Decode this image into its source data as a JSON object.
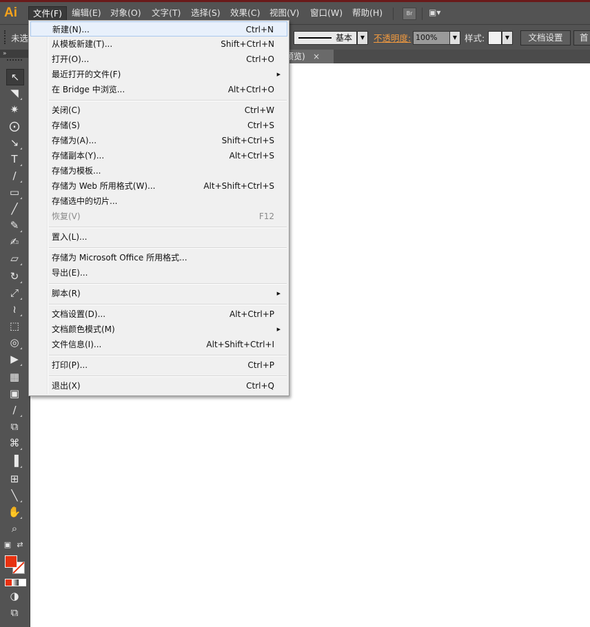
{
  "app": {
    "logo": "Ai"
  },
  "menubar": {
    "items": [
      "文件(F)",
      "编辑(E)",
      "对象(O)",
      "文字(T)",
      "选择(S)",
      "效果(C)",
      "视图(V)",
      "窗口(W)",
      "帮助(H)"
    ],
    "bridge_button": "Br",
    "workspace_button": "▣▾"
  },
  "control_bar": {
    "selection_label": "未选",
    "stroke_style": "基本",
    "opacity_label": "不透明度:",
    "opacity_value": "100%",
    "style_label": "样式:",
    "doc_setup_button": "文档设置",
    "first_button": "首"
  },
  "document_tab": {
    "label": "预览)",
    "close": "×"
  },
  "toolbar": {
    "collapse": "»"
  },
  "file_menu": [
    {
      "label": "新建(N)...",
      "shortcut": "Ctrl+N",
      "highlighted": true
    },
    {
      "label": "从模板新建(T)...",
      "shortcut": "Shift+Ctrl+N"
    },
    {
      "label": "打开(O)...",
      "shortcut": "Ctrl+O"
    },
    {
      "label": "最近打开的文件(F)",
      "shortcut": "",
      "submenu": true
    },
    {
      "label": "在 Bridge 中浏览...",
      "shortcut": "Alt+Ctrl+O"
    },
    {
      "label": "关闭(C)",
      "shortcut": "Ctrl+W"
    },
    {
      "label": "存储(S)",
      "shortcut": "Ctrl+S"
    },
    {
      "label": "存储为(A)...",
      "shortcut": "Shift+Ctrl+S"
    },
    {
      "label": "存储副本(Y)...",
      "shortcut": "Alt+Ctrl+S"
    },
    {
      "label": "存储为模板...",
      "shortcut": ""
    },
    {
      "label": "存储为 Web 所用格式(W)...",
      "shortcut": "Alt+Shift+Ctrl+S"
    },
    {
      "label": "存储选中的切片...",
      "shortcut": ""
    },
    {
      "label": "恢复(V)",
      "shortcut": "F12",
      "disabled": true
    },
    {
      "label": "置入(L)...",
      "shortcut": ""
    },
    {
      "label": "存储为 Microsoft Office 所用格式...",
      "shortcut": ""
    },
    {
      "label": "导出(E)...",
      "shortcut": ""
    },
    {
      "label": "脚本(R)",
      "shortcut": "",
      "submenu": true
    },
    {
      "label": "文档设置(D)...",
      "shortcut": "Alt+Ctrl+P"
    },
    {
      "label": "文档颜色模式(M)",
      "shortcut": "",
      "submenu": true
    },
    {
      "label": "文件信息(I)...",
      "shortcut": "Alt+Shift+Ctrl+I"
    },
    {
      "label": "打印(P)...",
      "shortcut": "Ctrl+P"
    },
    {
      "label": "退出(X)",
      "shortcut": "Ctrl+Q"
    }
  ],
  "colors": {
    "fill": "#e8320f",
    "menubar": "#535353",
    "accent": "#f7a21b",
    "menu_bg": "#f0f0f0"
  }
}
